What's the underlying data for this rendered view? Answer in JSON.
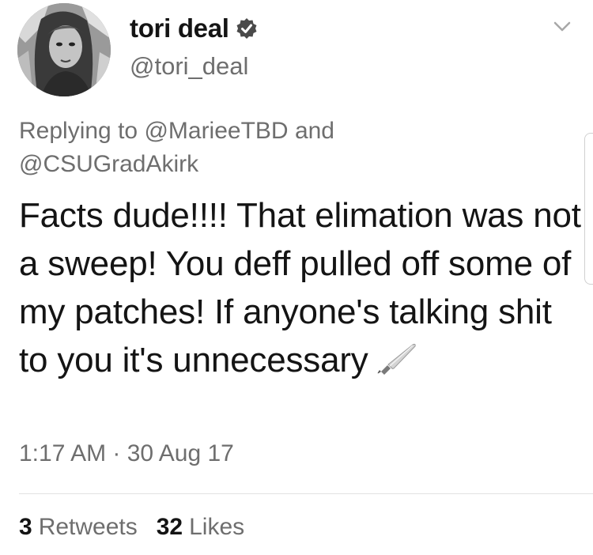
{
  "author": {
    "display_name": "tori deal",
    "handle": "@tori_deal"
  },
  "reply": {
    "prefix": "Replying to",
    "mention_1": "@MarieeTBD",
    "joiner": "and",
    "mention_2": "@CSUGradAkirk"
  },
  "tweet": {
    "text": "Facts dude!!!! That elimation was not a sweep! You deff pulled off some of my patches! If anyone's talking shit to you it's unnecessary",
    "emoji_icon": "knife-icon"
  },
  "meta": {
    "timestamp": "1:17 AM · 30 Aug 17"
  },
  "stats": {
    "retweets_count": "3",
    "retweets_label": "Retweets",
    "likes_count": "32",
    "likes_label": "Likes"
  }
}
